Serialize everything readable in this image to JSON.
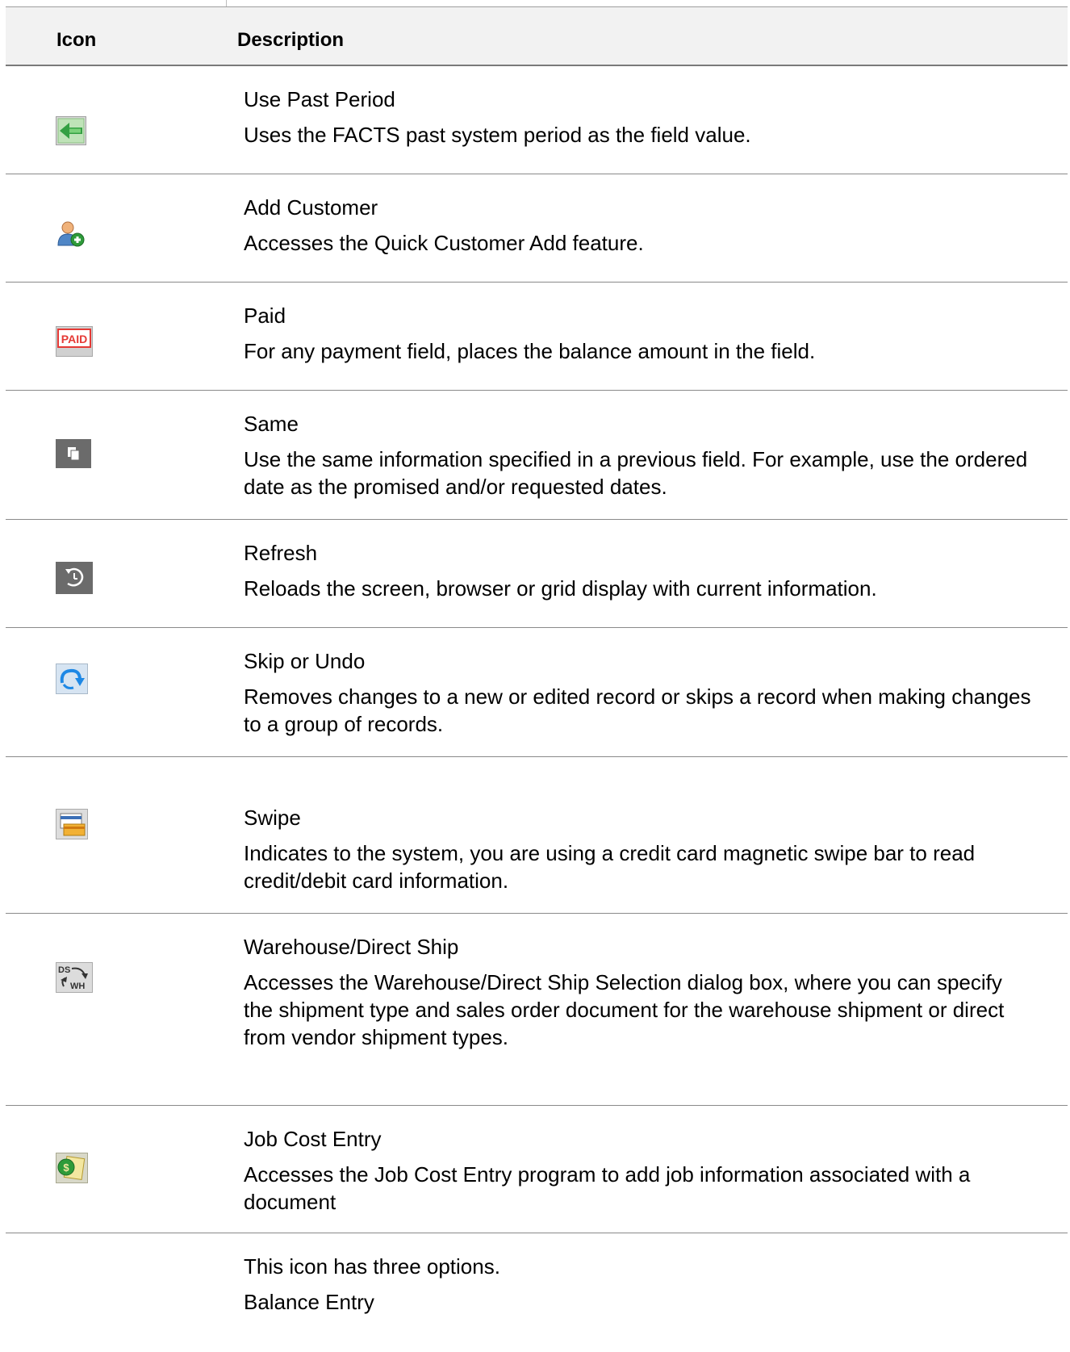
{
  "table": {
    "headers": {
      "icon": "Icon",
      "description": "Description"
    },
    "rows": [
      {
        "icon": "use-past-period-icon",
        "title": "Use Past Period",
        "text": "Uses the FACTS past system period as the field value."
      },
      {
        "icon": "add-customer-icon",
        "title": "Add Customer",
        "text": "Accesses the Quick Customer Add feature."
      },
      {
        "icon": "paid-icon",
        "title": "Paid",
        "text": "For any payment field, places the balance amount in the field."
      },
      {
        "icon": "same-icon",
        "title": "Same",
        "text": "Use the same information specified in a previous field. For example, use the ordered date as the promised and/or requested dates."
      },
      {
        "icon": "refresh-icon",
        "title": "Refresh",
        "text": "Reloads the screen, browser or grid display with current information."
      },
      {
        "icon": "skip-undo-icon",
        "title": "Skip or Undo",
        "text": "Removes changes to a new or edited record or skips a record when making changes to a group of records."
      },
      {
        "icon": "swipe-icon",
        "title": "Swipe",
        "text": "Indicates to the system, you are using a credit card magnetic swipe bar to read credit/debit card information."
      },
      {
        "icon": "warehouse-direct-ship-icon",
        "title": "Warehouse/Direct Ship",
        "text": "Accesses the Warehouse/Direct Ship Selection dialog box, where you can specify the shipment type and sales order document for the warehouse shipment or direct from vendor shipment types."
      },
      {
        "icon": "job-cost-entry-icon",
        "title": "Job Cost Entry",
        "text": "Accesses the Job Cost Entry program to add job information associated with a document"
      },
      {
        "icon": "",
        "title": "This icon has three options.",
        "text": "Balance Entry"
      }
    ]
  },
  "colors": {
    "paid_red": "#e53935",
    "green": "#2e9b3a",
    "blue": "#1e88e5",
    "gray_icon": "#6b6b6b"
  }
}
